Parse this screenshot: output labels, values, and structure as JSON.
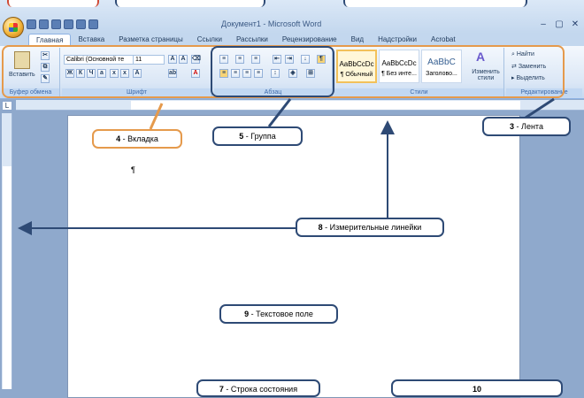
{
  "window": {
    "title": "Документ1 - Microsoft Word"
  },
  "tabs": [
    "Главная",
    "Вставка",
    "Разметка страницы",
    "Ссылки",
    "Рассылки",
    "Рецензирование",
    "Вид",
    "Надстройки",
    "Acrobat"
  ],
  "ribbon": {
    "clipboard": {
      "label": "Буфер обмена",
      "paste": "Вставить"
    },
    "font": {
      "label": "Шрифт",
      "name": "Calibri (Основной те",
      "size": "11"
    },
    "paragraph": {
      "label": "Абзац"
    },
    "styles": {
      "label": "Стили",
      "items": [
        {
          "sample": "AaBbCcDc",
          "name": "¶ Обычный"
        },
        {
          "sample": "AaBbCcDc",
          "name": "¶ Без инте..."
        },
        {
          "sample": "AaBbC",
          "name": "Заголово..."
        }
      ],
      "change": "Изменить стили"
    },
    "editing": {
      "label": "Редактирование",
      "find": "Найти",
      "replace": "Заменить",
      "select": "Выделить"
    }
  },
  "document": {
    "paragraph_mark": "¶"
  },
  "callouts": {
    "tab": {
      "num": "4",
      "text": " - Вкладка"
    },
    "group": {
      "num": "5",
      "text": " - Группа"
    },
    "ribbon": {
      "num": "3",
      "text": " - Лента"
    },
    "rulers": {
      "num": "8",
      "text": " - Измерительные линейки"
    },
    "textarea": {
      "num": "9",
      "text": " - Текстовое поле"
    },
    "statusbar": {
      "num": "7",
      "text": " - Строка состояния"
    },
    "bottom_right": {
      "num": "10",
      "text": ""
    }
  },
  "colors": {
    "callout_border": "#2e4a75",
    "ribbon_highlight": "#e59a4c",
    "group_highlight": "#2e4a75",
    "orb_highlight": "#d04a35"
  }
}
